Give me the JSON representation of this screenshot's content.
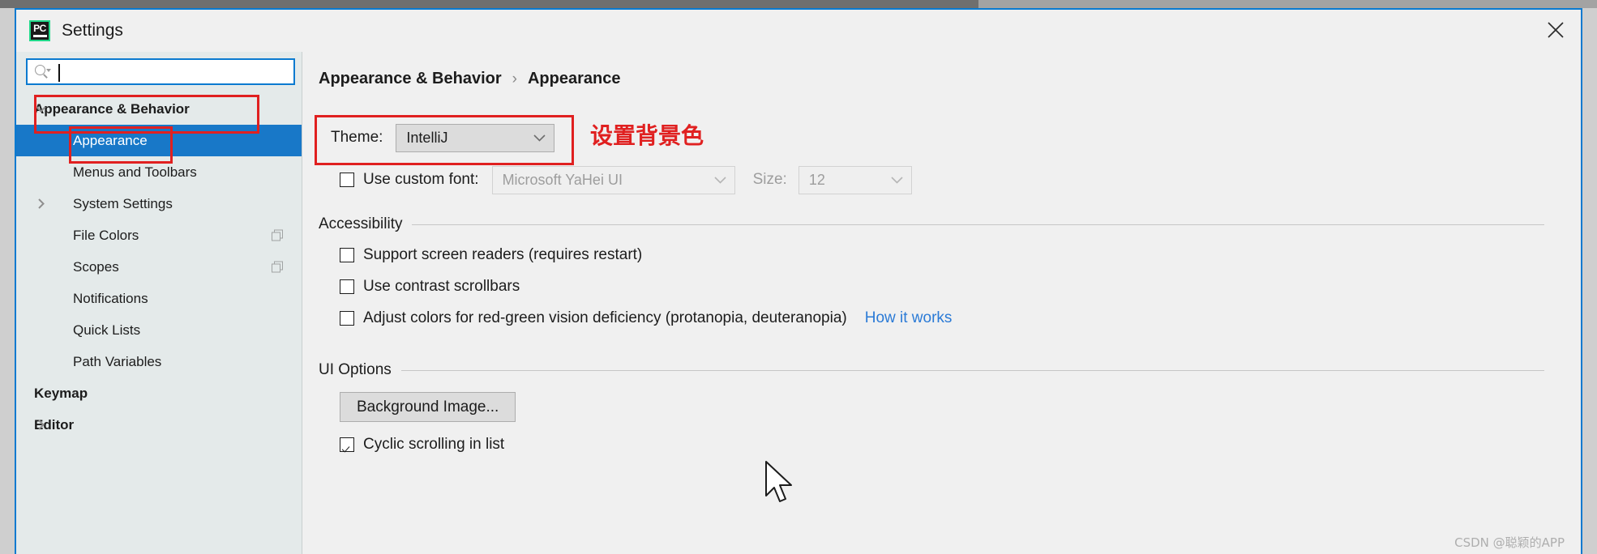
{
  "window": {
    "title": "Settings",
    "app_icon": "pycharm-icon",
    "icon_text": "PC",
    "close_icon": "close-icon",
    "accent": "#0a7ad0",
    "icon_accent": "#21d789"
  },
  "search": {
    "icon": "search-icon",
    "value": "",
    "placeholder": ""
  },
  "sidebar": {
    "items": [
      {
        "label": "Appearance & Behavior",
        "level": 0,
        "twisty": "chevron-down-icon",
        "selected": false,
        "bold": true,
        "trailing": null
      },
      {
        "label": "Appearance",
        "level": 1,
        "twisty": null,
        "selected": true,
        "bold": false,
        "trailing": null
      },
      {
        "label": "Menus and Toolbars",
        "level": 1,
        "twisty": null,
        "selected": false,
        "bold": false,
        "trailing": null
      },
      {
        "label": "System Settings",
        "level": 1,
        "twisty": "chevron-right-icon",
        "selected": false,
        "bold": false,
        "trailing": "copy-icon"
      },
      {
        "label": "File Colors",
        "level": 1,
        "twisty": null,
        "selected": false,
        "bold": false,
        "trailing": "copy-icon"
      },
      {
        "label": "Scopes",
        "level": 1,
        "twisty": null,
        "selected": false,
        "bold": false,
        "trailing": "copy-icon"
      },
      {
        "label": "Notifications",
        "level": 1,
        "twisty": null,
        "selected": false,
        "bold": false,
        "trailing": null
      },
      {
        "label": "Quick Lists",
        "level": 1,
        "twisty": null,
        "selected": false,
        "bold": false,
        "trailing": null
      },
      {
        "label": "Path Variables",
        "level": 1,
        "twisty": null,
        "selected": false,
        "bold": false,
        "trailing": null
      },
      {
        "label": "Keymap",
        "level": 0,
        "twisty": null,
        "selected": false,
        "bold": true,
        "trailing": null
      },
      {
        "label": "Editor",
        "level": 0,
        "twisty": "chevron-right-icon",
        "selected": false,
        "bold": true,
        "trailing": null
      }
    ]
  },
  "breadcrumb": {
    "parent": "Appearance & Behavior",
    "separator": "›",
    "current": "Appearance"
  },
  "theme": {
    "label": "Theme:",
    "value": "IntelliJ",
    "chevron": "chevron-down-icon"
  },
  "font": {
    "checkbox_label": "Use custom font:",
    "checked": false,
    "value": "Microsoft YaHei UI",
    "size_label": "Size:",
    "size_value": "12",
    "disabled": true
  },
  "accessibility": {
    "title": "Accessibility",
    "options": [
      {
        "label": "Support screen readers (requires restart)",
        "checked": false,
        "link": null
      },
      {
        "label": "Use contrast scrollbars",
        "checked": false,
        "link": null
      },
      {
        "label": "Adjust colors for red-green vision deficiency (protanopia, deuteranopia)",
        "checked": false,
        "link": "How it works"
      }
    ]
  },
  "ui_options": {
    "title": "UI Options",
    "background_image_button": "Background Image...",
    "cyclic_label": "Cyclic scrolling in list",
    "cyclic_checked": true
  },
  "annotations": {
    "color": "#e02020",
    "note_text": "设置背景色",
    "boxes": [
      "sidebar-appearance-behavior",
      "sidebar-appearance",
      "theme-row"
    ]
  },
  "watermark": {
    "text": "CSDN @聪颖的APP"
  }
}
